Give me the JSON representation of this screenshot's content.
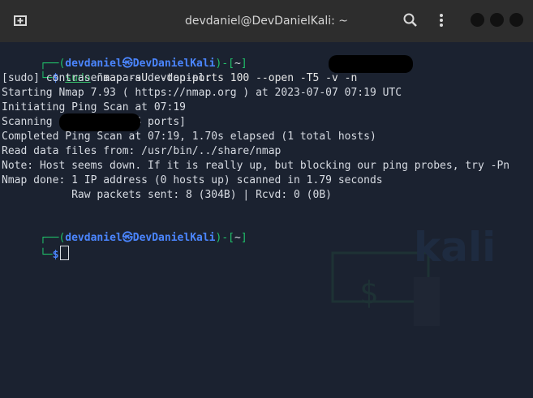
{
  "window": {
    "title": "devdaniel@DevDanielKali: ~"
  },
  "icons": {
    "new_tab": "new-tab-icon",
    "search": "search-icon",
    "menu": "menu-kebab-icon"
  },
  "prompt": {
    "user": "devdaniel",
    "host": "DevDanielKali",
    "dir": "~",
    "symbol": "$"
  },
  "terminal": {
    "command_sudo": "sudo",
    "command_rest": " nmap -sU --top-ports 100 --open -T5 -v -n",
    "lines": [
      "[sudo] contraseña para devdaniel:",
      "Starting Nmap 7.93 ( https://nmap.org ) at 2023-07-07 07:19 UTC",
      "Initiating Ping Scan at 07:19",
      "Scanning            [4 ports]",
      "Completed Ping Scan at 07:19, 1.70s elapsed (1 total hosts)",
      "Read data files from: /usr/bin/../share/nmap",
      "Note: Host seems down. If it is really up, but blocking our ping probes, try -Pn",
      "Nmap done: 1 IP address (0 hosts up) scanned in 1.79 seconds",
      "           Raw packets sent: 8 (304B) | Rcvd: 0 (0B)"
    ]
  },
  "colors": {
    "prompt_green": "#20c36b",
    "prompt_blue": "#4b86ff"
  }
}
